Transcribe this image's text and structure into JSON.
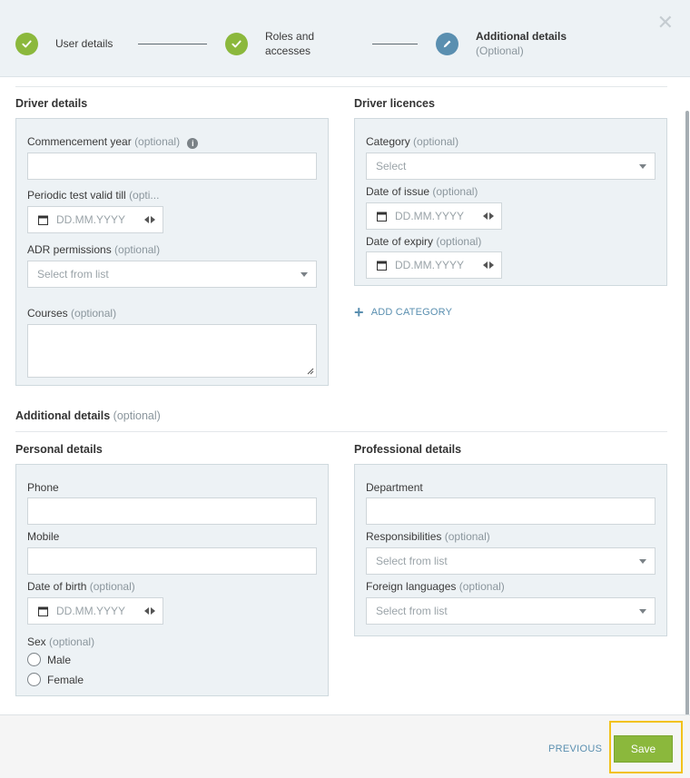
{
  "stepper": {
    "steps": [
      {
        "label": "User details",
        "state": "done"
      },
      {
        "label": "Roles and",
        "label2": "accesses",
        "state": "done"
      },
      {
        "label": "Additional details",
        "sub": "(Optional)",
        "state": "current"
      }
    ],
    "close_icon": "close-icon"
  },
  "driver_details": {
    "title": "Driver details",
    "commencement_year": {
      "label": "Commencement year",
      "opt": "(optional)",
      "value": ""
    },
    "periodic_test": {
      "label": "Periodic test valid till",
      "opt": "(opti...",
      "placeholder": "DD.MM.YYYY"
    },
    "adr_permissions": {
      "label": "ADR permissions",
      "opt": "(optional)",
      "placeholder": "Select from list"
    },
    "courses": {
      "label": "Courses",
      "opt": "(optional)",
      "value": ""
    }
  },
  "driver_licences": {
    "title": "Driver licences",
    "category": {
      "label": "Category",
      "opt": "(optional)",
      "placeholder": "Select"
    },
    "date_of_issue": {
      "label": "Date of issue",
      "opt": "(optional)",
      "placeholder": "DD.MM.YYYY"
    },
    "date_of_expiry": {
      "label": "Date of expiry",
      "opt": "(optional)",
      "placeholder": "DD.MM.YYYY"
    },
    "add_category": "ADD CATEGORY"
  },
  "additional_details": {
    "title": "Additional details",
    "opt": "(optional)"
  },
  "personal_details": {
    "title": "Personal details",
    "phone": {
      "label": "Phone",
      "value": ""
    },
    "mobile": {
      "label": "Mobile",
      "value": ""
    },
    "date_of_birth": {
      "label": "Date of birth",
      "opt": "(optional)",
      "placeholder": "DD.MM.YYYY"
    },
    "sex": {
      "label": "Sex",
      "opt": "(optional)",
      "options": [
        "Male",
        "Female"
      ]
    }
  },
  "professional_details": {
    "title": "Professional details",
    "department": {
      "label": "Department",
      "value": ""
    },
    "responsibilities": {
      "label": "Responsibilities",
      "opt": "(optional)",
      "placeholder": "Select from list"
    },
    "foreign_languages": {
      "label": "Foreign languages",
      "opt": "(optional)",
      "placeholder": "Select from list"
    }
  },
  "footer": {
    "previous_label": "PREVIOUS",
    "save_label": "Save"
  },
  "colors": {
    "accent_green": "#8bb83c",
    "accent_blue": "#5a8fb0",
    "highlight": "#f2c21b"
  }
}
